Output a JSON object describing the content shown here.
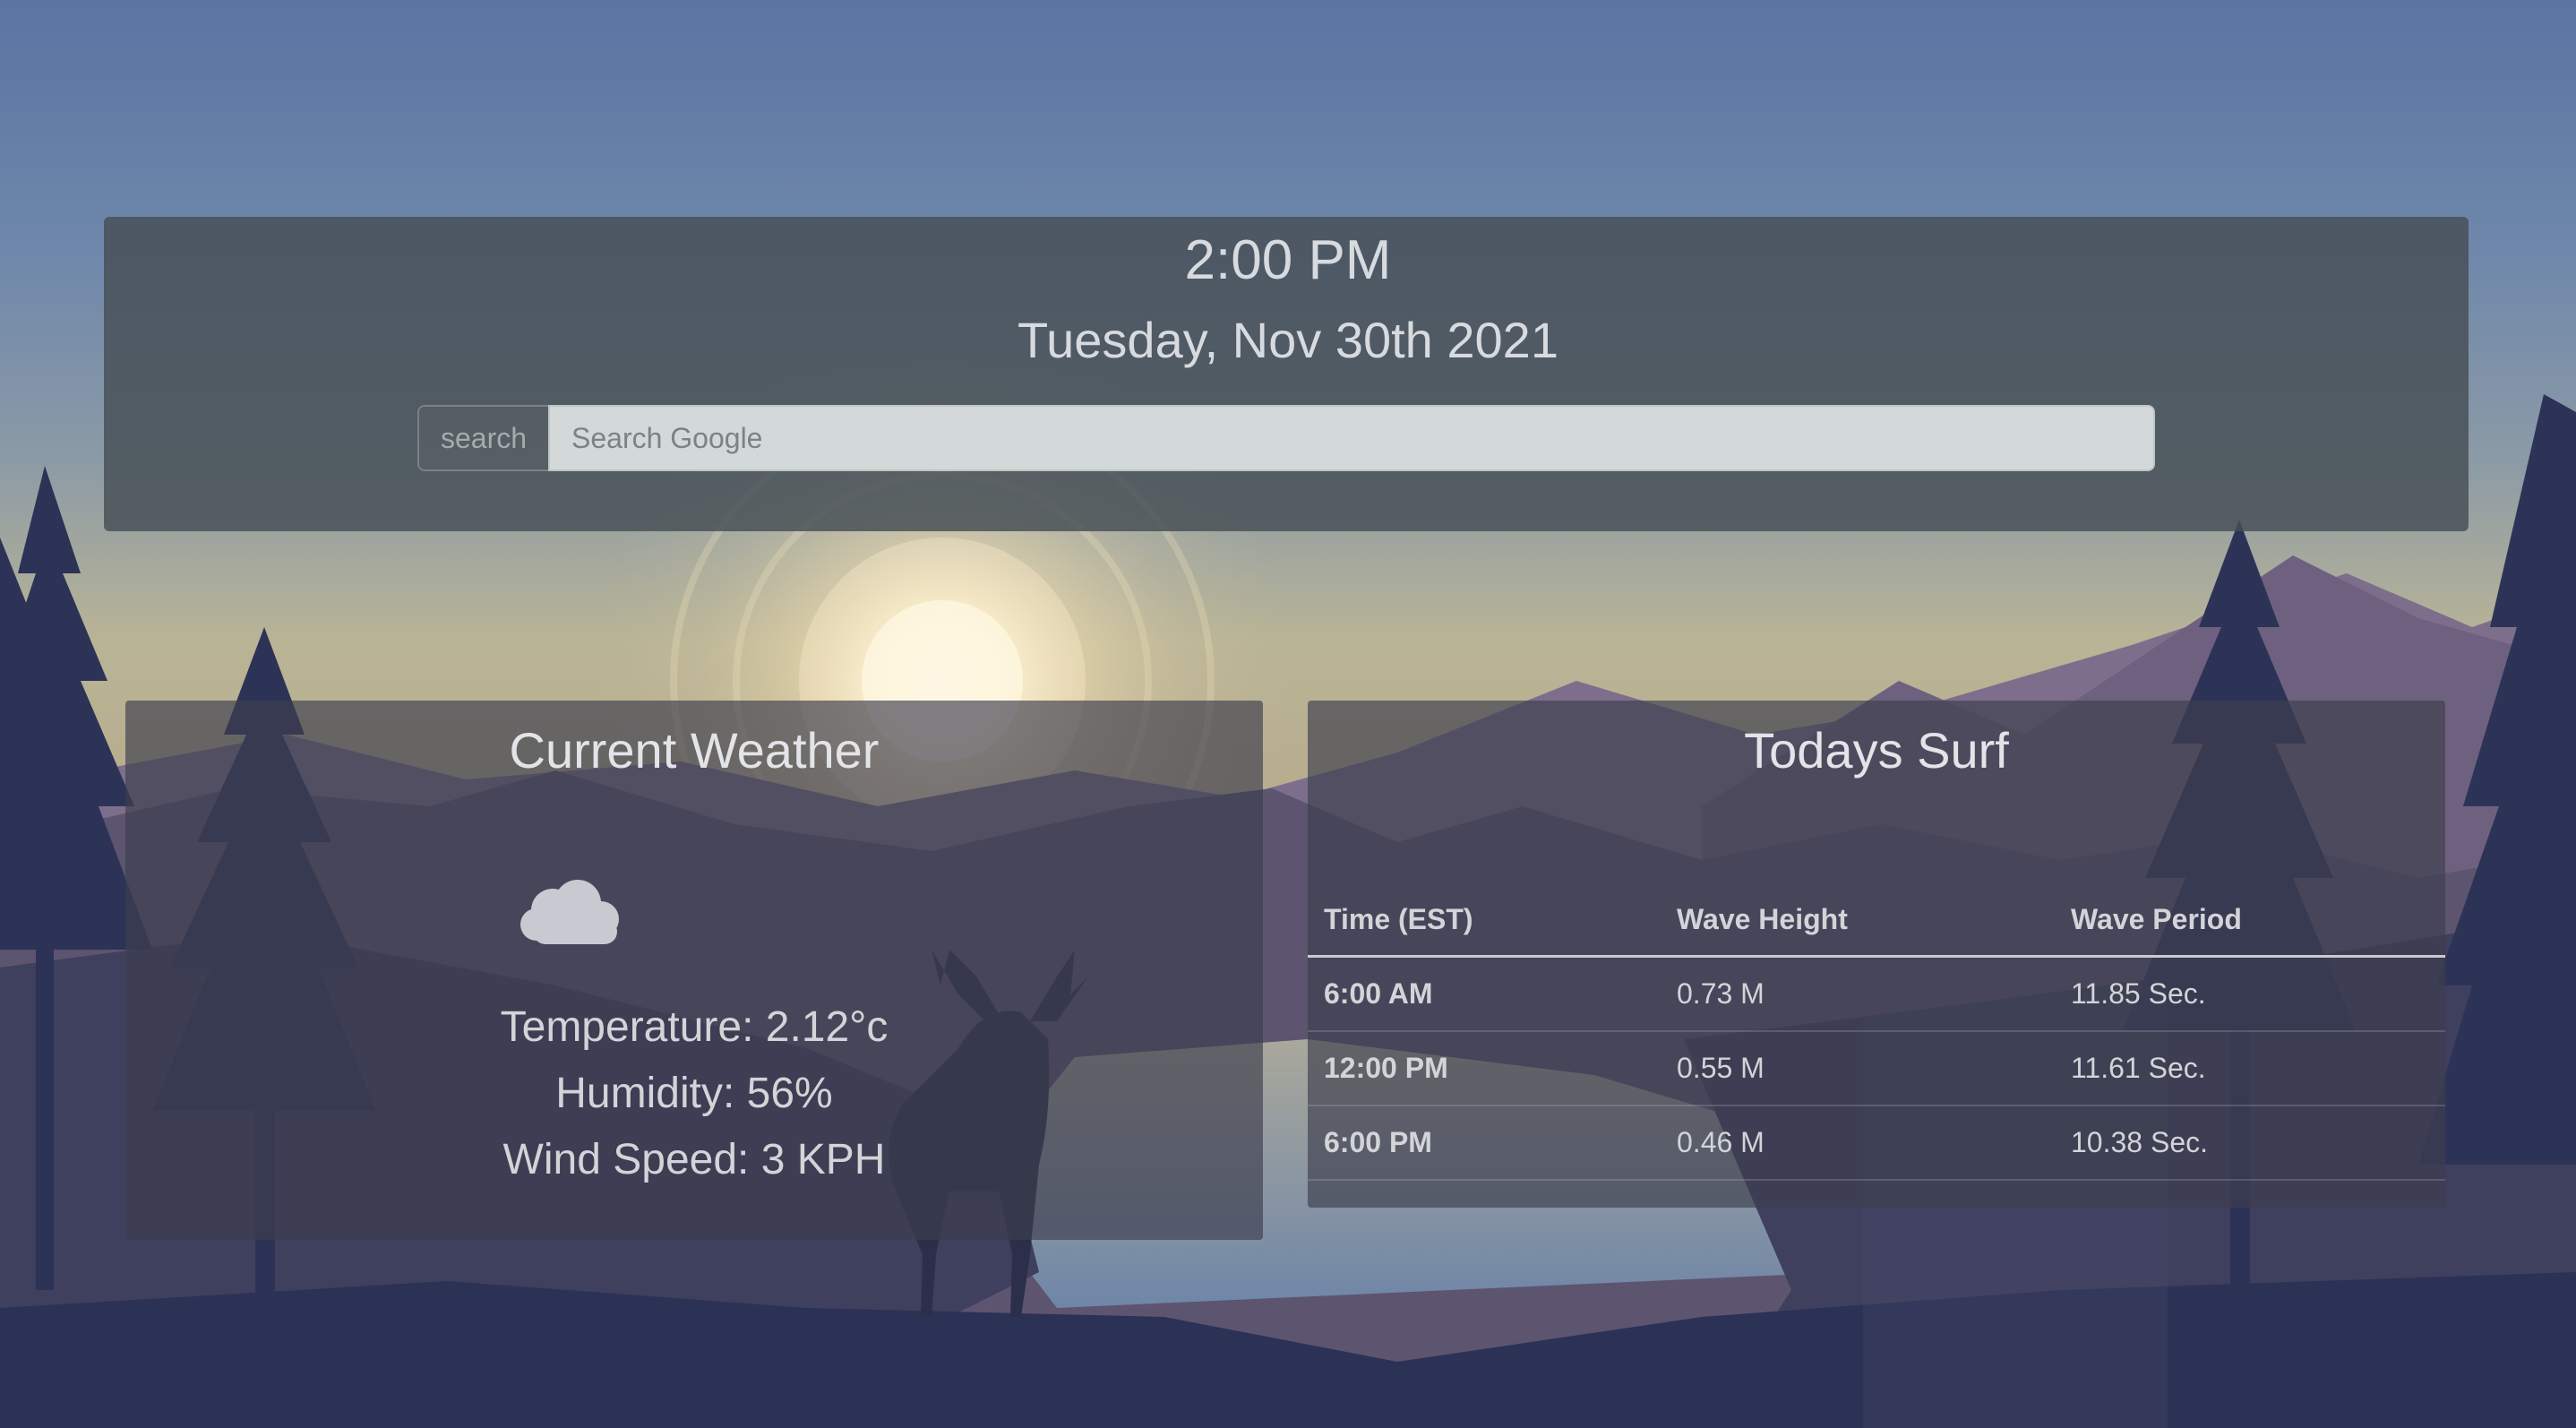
{
  "header": {
    "time": "2:00 PM",
    "date": "Tuesday, Nov 30th 2021"
  },
  "search": {
    "button_label": "search",
    "placeholder": "Search Google",
    "value": ""
  },
  "weather": {
    "title": "Current Weather",
    "icon": "cloud-icon",
    "temperature": "Temperature: 2.12°c",
    "humidity": "Humidity: 56%",
    "wind_speed": "Wind Speed: 3 KPH"
  },
  "surf": {
    "title": "Todays Surf",
    "columns": [
      "Time (EST)",
      "Wave Height",
      "Wave Period"
    ],
    "rows": [
      {
        "time": "6:00 AM",
        "height": "0.73 M",
        "period": "11.85 Sec."
      },
      {
        "time": "12:00 PM",
        "height": "0.55 M",
        "period": "11.61 Sec."
      },
      {
        "time": "6:00 PM",
        "height": "0.46 M",
        "period": "10.38 Sec."
      }
    ]
  },
  "colors": {
    "sky_top": "#5f7aa8",
    "sky_horizon": "#b8b292",
    "sun_glow": "#fff6dc",
    "mountain_far": "#8a7a94",
    "mountain_mid": "#5c5470",
    "forest_dark": "#2c3255",
    "lake": "#8fa1b4",
    "panel": "#464e54",
    "text_light": "#d7dade"
  }
}
